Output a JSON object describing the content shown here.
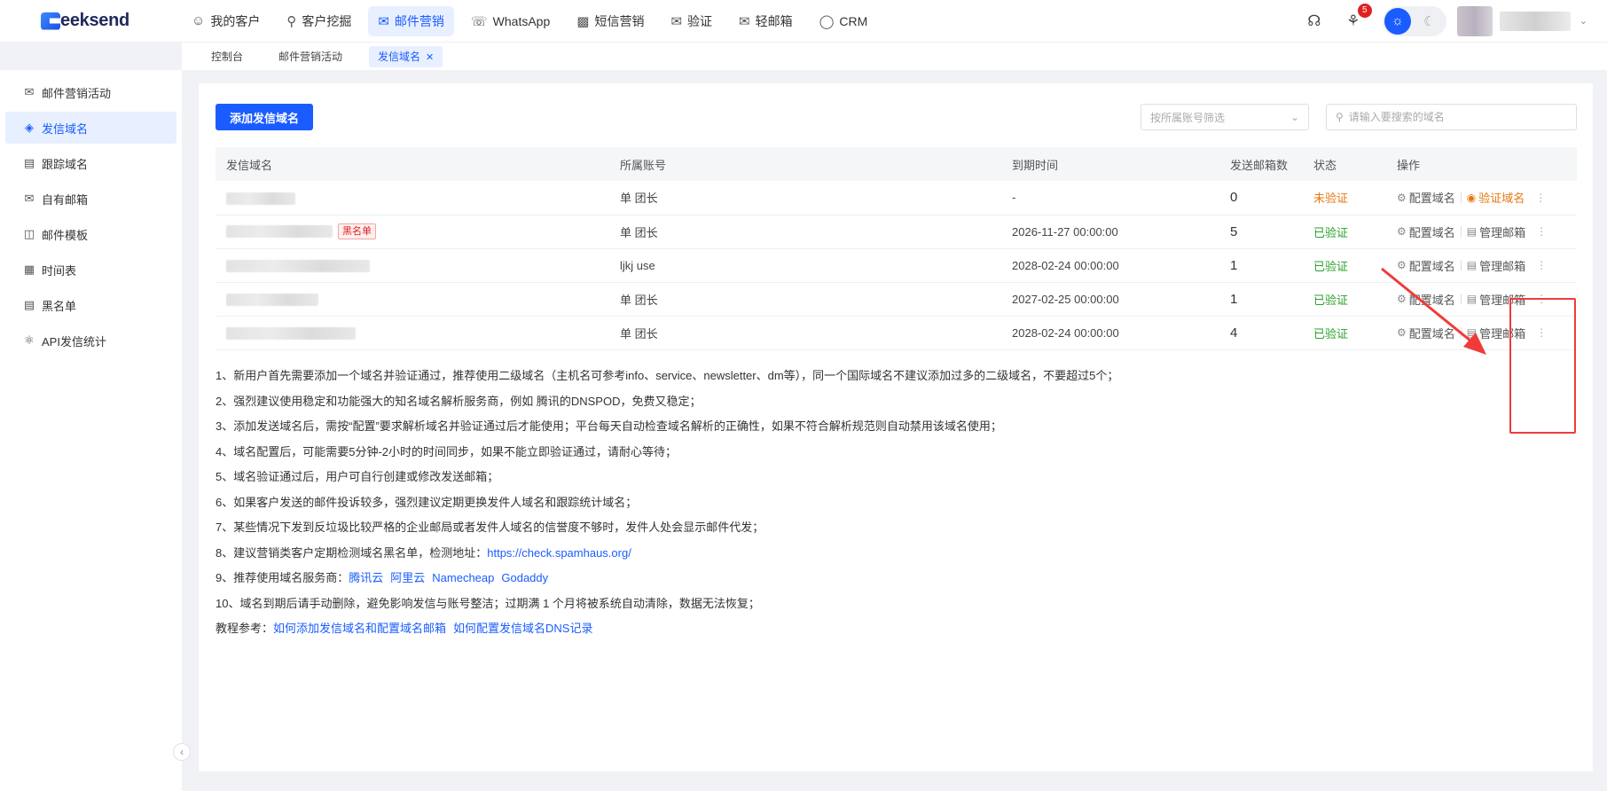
{
  "brand": {
    "logo_text": "eeksend"
  },
  "nav": [
    {
      "label": "我的客户",
      "icon": "person-icon"
    },
    {
      "label": "客户挖掘",
      "icon": "search-icon"
    },
    {
      "label": "邮件营销",
      "icon": "mail-icon",
      "active": true
    },
    {
      "label": "WhatsApp",
      "icon": "whatsapp-icon"
    },
    {
      "label": "短信营销",
      "icon": "sms-icon"
    },
    {
      "label": "验证",
      "icon": "verify-mail-icon"
    },
    {
      "label": "轻邮箱",
      "icon": "light-mail-icon"
    },
    {
      "label": "CRM",
      "icon": "crm-icon"
    }
  ],
  "header": {
    "notification_count": "5"
  },
  "subtabs": [
    {
      "label": "控制台"
    },
    {
      "label": "邮件营销活动"
    },
    {
      "label": "发信域名",
      "active": true
    }
  ],
  "sidebar": [
    {
      "label": "邮件营销活动",
      "icon": "campaign-icon"
    },
    {
      "label": "发信域名",
      "icon": "domain-icon",
      "active": true
    },
    {
      "label": "跟踪域名",
      "icon": "tracking-icon"
    },
    {
      "label": "自有邮箱",
      "icon": "mailbox-icon"
    },
    {
      "label": "邮件模板",
      "icon": "template-icon"
    },
    {
      "label": "时间表",
      "icon": "calendar-icon"
    },
    {
      "label": "黑名单",
      "icon": "blacklist-icon"
    },
    {
      "label": "API发信统计",
      "icon": "api-icon"
    }
  ],
  "toolbar": {
    "add_button": "添加发信域名",
    "filter_placeholder": "按所属账号筛选",
    "search_placeholder": "请输入要搜索的域名"
  },
  "table": {
    "headers": [
      "发信域名",
      "所属账号",
      "到期时间",
      "发送邮箱数",
      "状态",
      "操作"
    ],
    "rows": [
      {
        "account": "单 团长",
        "expiry": "-",
        "count": "0",
        "status": "未验证",
        "status_type": "unverified",
        "op1": "配置域名",
        "op2": "验证域名",
        "blacklisted": false
      },
      {
        "account": "单 团长",
        "expiry": "2026-11-27 00:00:00",
        "count": "5",
        "status": "已验证",
        "status_type": "verified",
        "op1": "配置域名",
        "op2": "管理邮箱",
        "blacklisted": true,
        "tag": "黑名单"
      },
      {
        "account": "ljkj use",
        "expiry": "2028-02-24 00:00:00",
        "count": "1",
        "status": "已验证",
        "status_type": "verified",
        "op1": "配置域名",
        "op2": "管理邮箱",
        "blacklisted": false
      },
      {
        "account": "单 团长",
        "expiry": "2027-02-25 00:00:00",
        "count": "1",
        "status": "已验证",
        "status_type": "verified",
        "op1": "配置域名",
        "op2": "管理邮箱",
        "blacklisted": false
      },
      {
        "account": "单 团长",
        "expiry": "2028-02-24 00:00:00",
        "count": "4",
        "status": "已验证",
        "status_type": "verified",
        "op1": "配置域名",
        "op2": "管理邮箱",
        "blacklisted": false
      }
    ]
  },
  "notes": {
    "n1": "1、新用户首先需要添加一个域名并验证通过，推荐使用二级域名（主机名可参考info、service、newsletter、dm等），同一个国际域名不建议添加过多的二级域名，不要超过5个；",
    "n2": "2、强烈建议使用稳定和功能强大的知名域名解析服务商，例如 腾讯的DNSPOD，免费又稳定；",
    "n3": "3、添加发送域名后，需按“配置”要求解析域名并验证通过后才能使用；平台每天自动检查域名解析的正确性，如果不符合解析规范则自动禁用该域名使用；",
    "n4": "4、域名配置后，可能需要5分钟-2小时的时间同步，如果不能立即验证通过，请耐心等待；",
    "n5": "5、域名验证通过后，用户可自行创建或修改发送邮箱；",
    "n6": "6、如果客户发送的邮件投诉较多，强烈建议定期更换发件人域名和跟踪统计域名；",
    "n7": "7、某些情况下发到反垃圾比较严格的企业邮局或者发件人域名的信誉度不够时，发件人处会显示邮件代发；",
    "n8_prefix": "8、建议营销类客户定期检测域名黑名单，检测地址：",
    "n8_link": "https://check.spamhaus.org/",
    "n9_prefix": "9、推荐使用域名服务商：",
    "n9_links": [
      "腾讯云",
      "阿里云",
      "Namecheap",
      "Godaddy"
    ],
    "n10": "10、域名到期后请手动删除，避免影响发信与账号整洁；过期满 1 个月将被系统自动清除，数据无法恢复；",
    "tutorial_prefix": "教程参考：",
    "tutorial_links": [
      "如何添加发信域名和配置域名邮箱",
      "如何配置发信域名DNS记录"
    ]
  },
  "colors": {
    "accent": "#1a5cff",
    "verified": "#2ba02b",
    "unverified": "#e6780f",
    "annotation": "#f03b3b"
  }
}
